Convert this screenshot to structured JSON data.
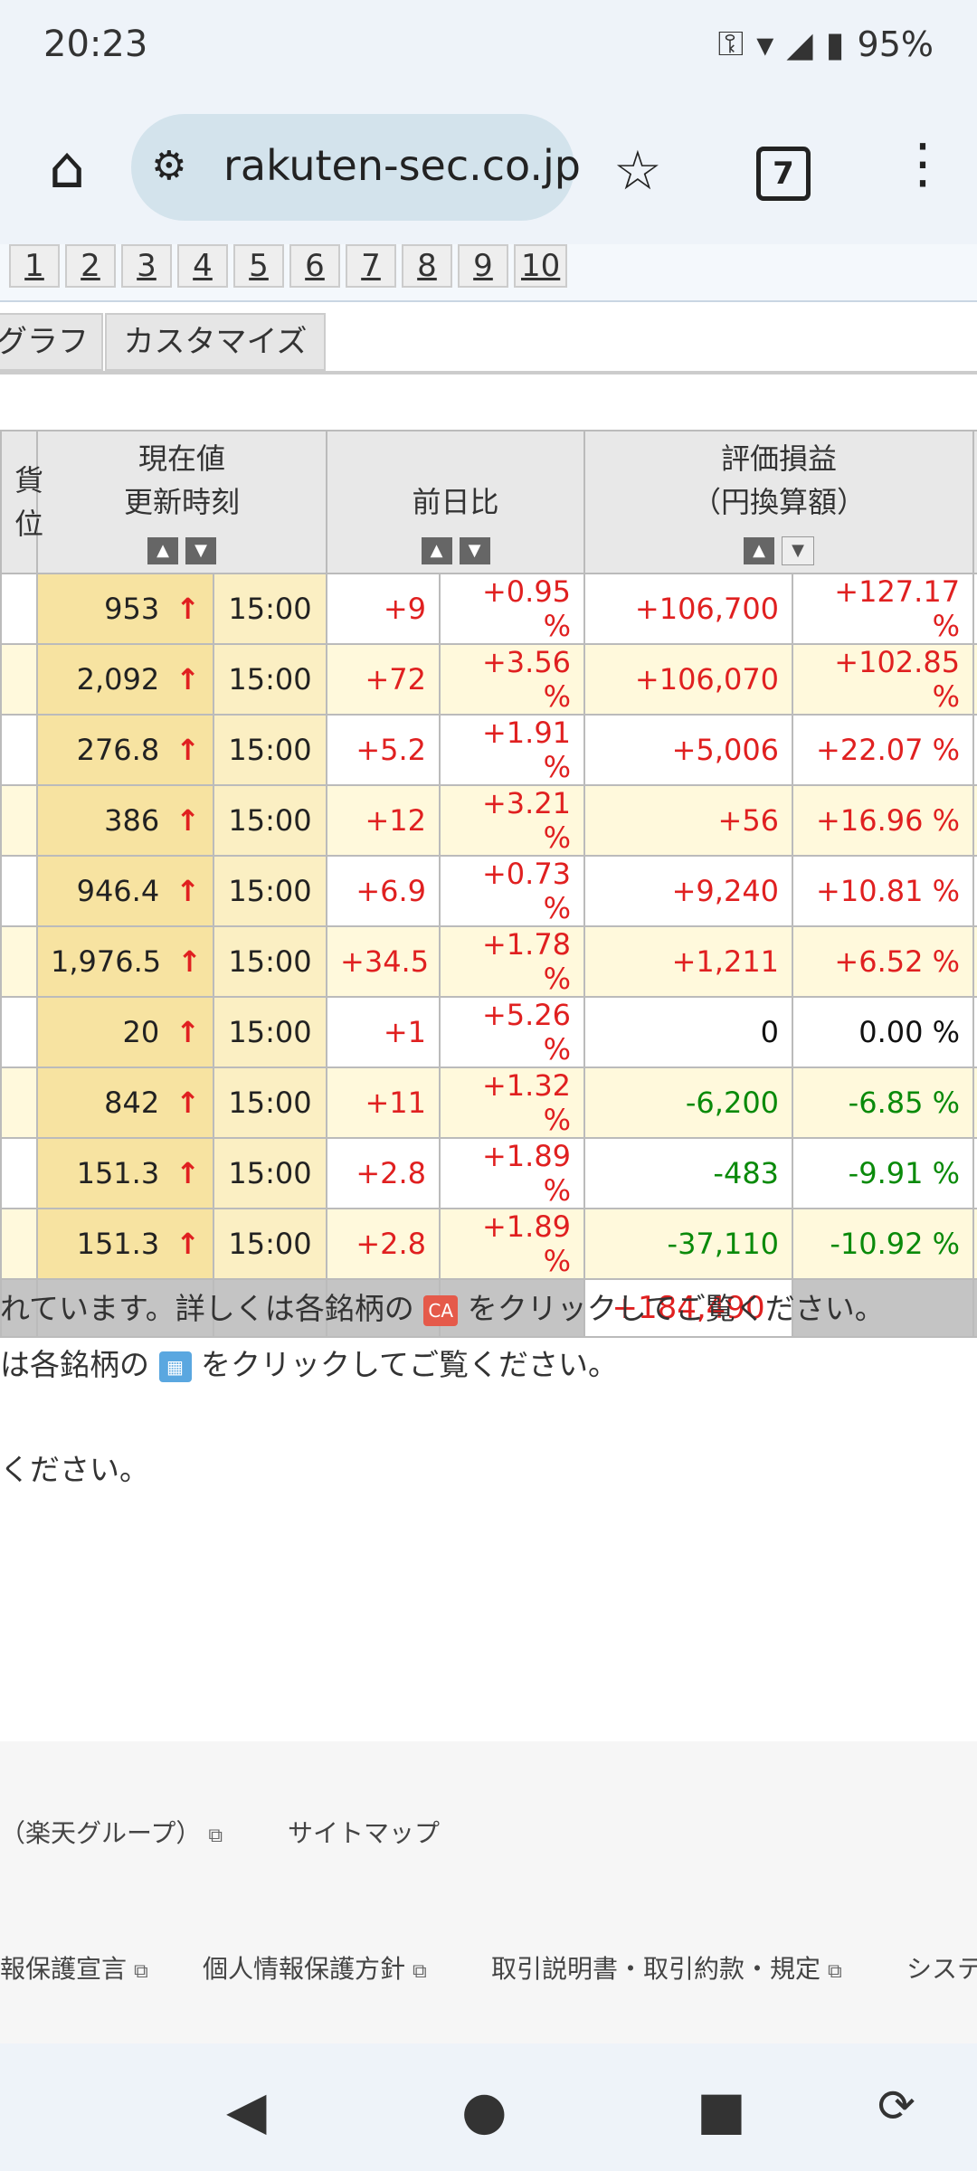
{
  "status": {
    "time": "20:23",
    "battery": "95%"
  },
  "browser": {
    "url": "rakuten-sec.co.jp",
    "tab_count": "7"
  },
  "pager": [
    "1",
    "2",
    "3",
    "4",
    "5",
    "6",
    "7",
    "8",
    "9",
    "10"
  ],
  "tabs": {
    "graph": "グラフ",
    "customize": "カスタマイズ"
  },
  "table": {
    "headers": {
      "col_left_line1": "貨",
      "col_left_line2": "位",
      "price_line1": "現在値",
      "price_line2": "更新時刻",
      "change": "前日比",
      "pl_line1": "評価損益",
      "pl_line2": "（円換算額）"
    },
    "rows": [
      {
        "price": "953",
        "time": "15:00",
        "chg": "+9",
        "chg_pct": "+0.95 %",
        "pl": "+106,700",
        "pl_pct": "+127.17 %",
        "pl_color": "up"
      },
      {
        "price": "2,092",
        "time": "15:00",
        "chg": "+72",
        "chg_pct": "+3.56 %",
        "pl": "+106,070",
        "pl_pct": "+102.85 %",
        "pl_color": "up"
      },
      {
        "price": "276.8",
        "time": "15:00",
        "chg": "+5.2",
        "chg_pct": "+1.91 %",
        "pl": "+5,006",
        "pl_pct": "+22.07 %",
        "pl_color": "up"
      },
      {
        "price": "386",
        "time": "15:00",
        "chg": "+12",
        "chg_pct": "+3.21 %",
        "pl": "+56",
        "pl_pct": "+16.96 %",
        "pl_color": "up"
      },
      {
        "price": "946.4",
        "time": "15:00",
        "chg": "+6.9",
        "chg_pct": "+0.73 %",
        "pl": "+9,240",
        "pl_pct": "+10.81 %",
        "pl_color": "up"
      },
      {
        "price": "1,976.5",
        "time": "15:00",
        "chg": "+34.5",
        "chg_pct": "+1.78 %",
        "pl": "+1,211",
        "pl_pct": "+6.52 %",
        "pl_color": "up"
      },
      {
        "price": "20",
        "time": "15:00",
        "chg": "+1",
        "chg_pct": "+5.26 %",
        "pl": "0",
        "pl_pct": "0.00 %",
        "pl_color": "bk"
      },
      {
        "price": "842",
        "time": "15:00",
        "chg": "+11",
        "chg_pct": "+1.32 %",
        "pl": "-6,200",
        "pl_pct": "-6.85 %",
        "pl_color": "dn"
      },
      {
        "price": "151.3",
        "time": "15:00",
        "chg": "+2.8",
        "chg_pct": "+1.89 %",
        "pl": "-483",
        "pl_pct": "-9.91 %",
        "pl_color": "dn"
      },
      {
        "price": "151.3",
        "time": "15:00",
        "chg": "+2.8",
        "chg_pct": "+1.89 %",
        "pl": "-37,110",
        "pl_pct": "-10.92 %",
        "pl_color": "dn"
      }
    ],
    "total_pl": "+184,490"
  },
  "notes": {
    "line1_a": "れています。詳しくは各銘柄の",
    "line1_b": "をクリックしてご覧ください。",
    "line2_a": "は各銘柄の",
    "line2_b": "をクリックしてご覧ください。",
    "line3": "ください。",
    "ca_icon_text": "CA"
  },
  "footer": {
    "rakuten_group": "（楽天グループ）",
    "sitemap": "サイトマップ",
    "privacy_decl": "報保護宣言",
    "privacy_policy": "個人情報保護方針",
    "terms": "取引説明書・取引約款・規定",
    "system": "システ"
  }
}
